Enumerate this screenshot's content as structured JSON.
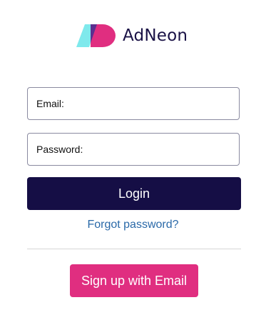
{
  "brand": {
    "name": "AdNeon",
    "logo_icon": "adneon-logo-icon",
    "colors": {
      "navy": "#150e45",
      "pink": "#e02e80",
      "cyan": "#7fe9ec"
    }
  },
  "form": {
    "email_label": "Email:",
    "email_value": "",
    "password_label": "Password:",
    "password_value": "",
    "login_label": "Login",
    "forgot_label": "Forgot password?"
  },
  "signup": {
    "label": "Sign up with Email",
    "color": "#e02e80"
  }
}
